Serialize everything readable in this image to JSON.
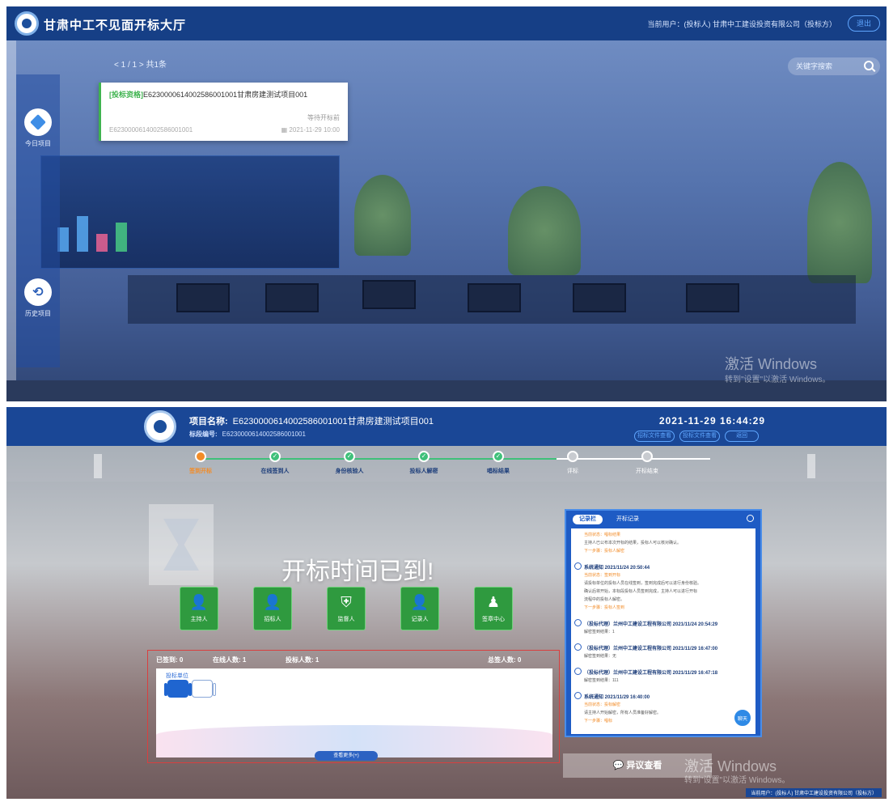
{
  "top": {
    "app_title": "甘肃中工不见面开标大厅",
    "user_info": "当前用户：(投标人) 甘肃中工建设投资有限公司（投标方）",
    "logout_label": "退出",
    "pager": "< 1 / 1 > 共1条",
    "search_placeholder": "关键字搜索",
    "sidebar": {
      "today_label": "今日项目",
      "history_label": "历史项目"
    },
    "card": {
      "tag": "[投标资格]",
      "title": "E6230000614002586001001甘肃房建测试项目001",
      "status": "等待开标前",
      "code": "E6230000614002586001001",
      "time": "2021-11-29 10:00"
    },
    "watermark_main": "激活 Windows",
    "watermark_sub": "转到\"设置\"以激活 Windows。"
  },
  "bottom": {
    "project_label": "项目名称:",
    "project_name": "E6230000614002586001001甘肃房建测试项目001",
    "code_label": "标段编号:",
    "code_value": "E6230000614002586001001",
    "datetime": "2021-11-29  16:44:29",
    "btn_tender_doc": "招标文件查看",
    "btn_bid_doc": "投标文件查看",
    "btn_back": "返回",
    "steps": [
      {
        "label": "签到开标",
        "state": "active"
      },
      {
        "label": "在线签到人",
        "state": "done"
      },
      {
        "label": "身份核验人",
        "state": "done"
      },
      {
        "label": "投标人解密",
        "state": "done"
      },
      {
        "label": "唱标结果",
        "state": "done"
      },
      {
        "label": "评标",
        "state": "todo"
      },
      {
        "label": "开标结束",
        "state": "todo"
      }
    ],
    "notice": "开标时间已到!",
    "roles": [
      "主持人",
      "招标人",
      "监督人",
      "记录人",
      "签章中心"
    ],
    "seat_stats": {
      "signed": "已签到: 0",
      "online": "在线人数: 1",
      "bidders": "投标人数: 1",
      "total": "总签人数: 0"
    },
    "seat_group_label": "投标单位",
    "more_btn": "查看更多(+)",
    "log_tabs": {
      "active": "记录栏",
      "inactive": "开标记录"
    },
    "log_entries": [
      {
        "head": "",
        "lines": [
          {
            "t": "当前状态：唱标结果",
            "c": "orange"
          },
          {
            "t": "主持人已公布本次开标的结果，投标人可以核对确认。",
            "c": "gray"
          },
          {
            "t": "下一步骤：投标人解密",
            "c": "orange"
          }
        ]
      },
      {
        "head": "系统通知 2021/11/24 20:50:44",
        "lines": [
          {
            "t": "当前状态：签到开标",
            "c": "orange"
          },
          {
            "t": "请投标单位的投标人员在线签到，签到完成后可以进行身份核验。",
            "c": "gray"
          },
          {
            "t": "确认后将开始，本标段投标人员签到完成，主持人可以进行开标",
            "c": "gray"
          },
          {
            "t": "流程中的投标人解密。",
            "c": "gray"
          },
          {
            "t": "下一步骤：投标人签到",
            "c": "orange"
          }
        ]
      },
      {
        "head": "（投标代理）兰州中工建设工程有限公司 2021/11/24 20:54:29",
        "lines": [
          {
            "t": "解密签到结果：1",
            "c": "gray"
          }
        ]
      },
      {
        "head": "（投标代理）兰州中工建设工程有限公司 2021/11/29 16:47:00",
        "lines": [
          {
            "t": "解密签到结果：无",
            "c": "gray"
          }
        ]
      },
      {
        "head": "（投标代理）兰州中工建设工程有限公司 2021/11/29 16:47:18",
        "lines": [
          {
            "t": "解密签到结果：111",
            "c": "gray"
          }
        ]
      },
      {
        "head": "系统通知 2021/11/29 16:40:00",
        "lines": [
          {
            "t": "当前状态：投标解密",
            "c": "orange"
          },
          {
            "t": "请主持人开始解密，所有人员准备好解密。",
            "c": "gray"
          },
          {
            "t": "下一步骤：唱标",
            "c": "orange"
          }
        ]
      }
    ],
    "chat_label": "聊天",
    "objection_btn": "异议查看",
    "footer_user": "当前用户：(投标人) 甘肃中工建设投资有限公司（投标方）",
    "watermark_main": "激活 Windows",
    "watermark_sub": "转到\"设置\"以激活 Windows。"
  }
}
